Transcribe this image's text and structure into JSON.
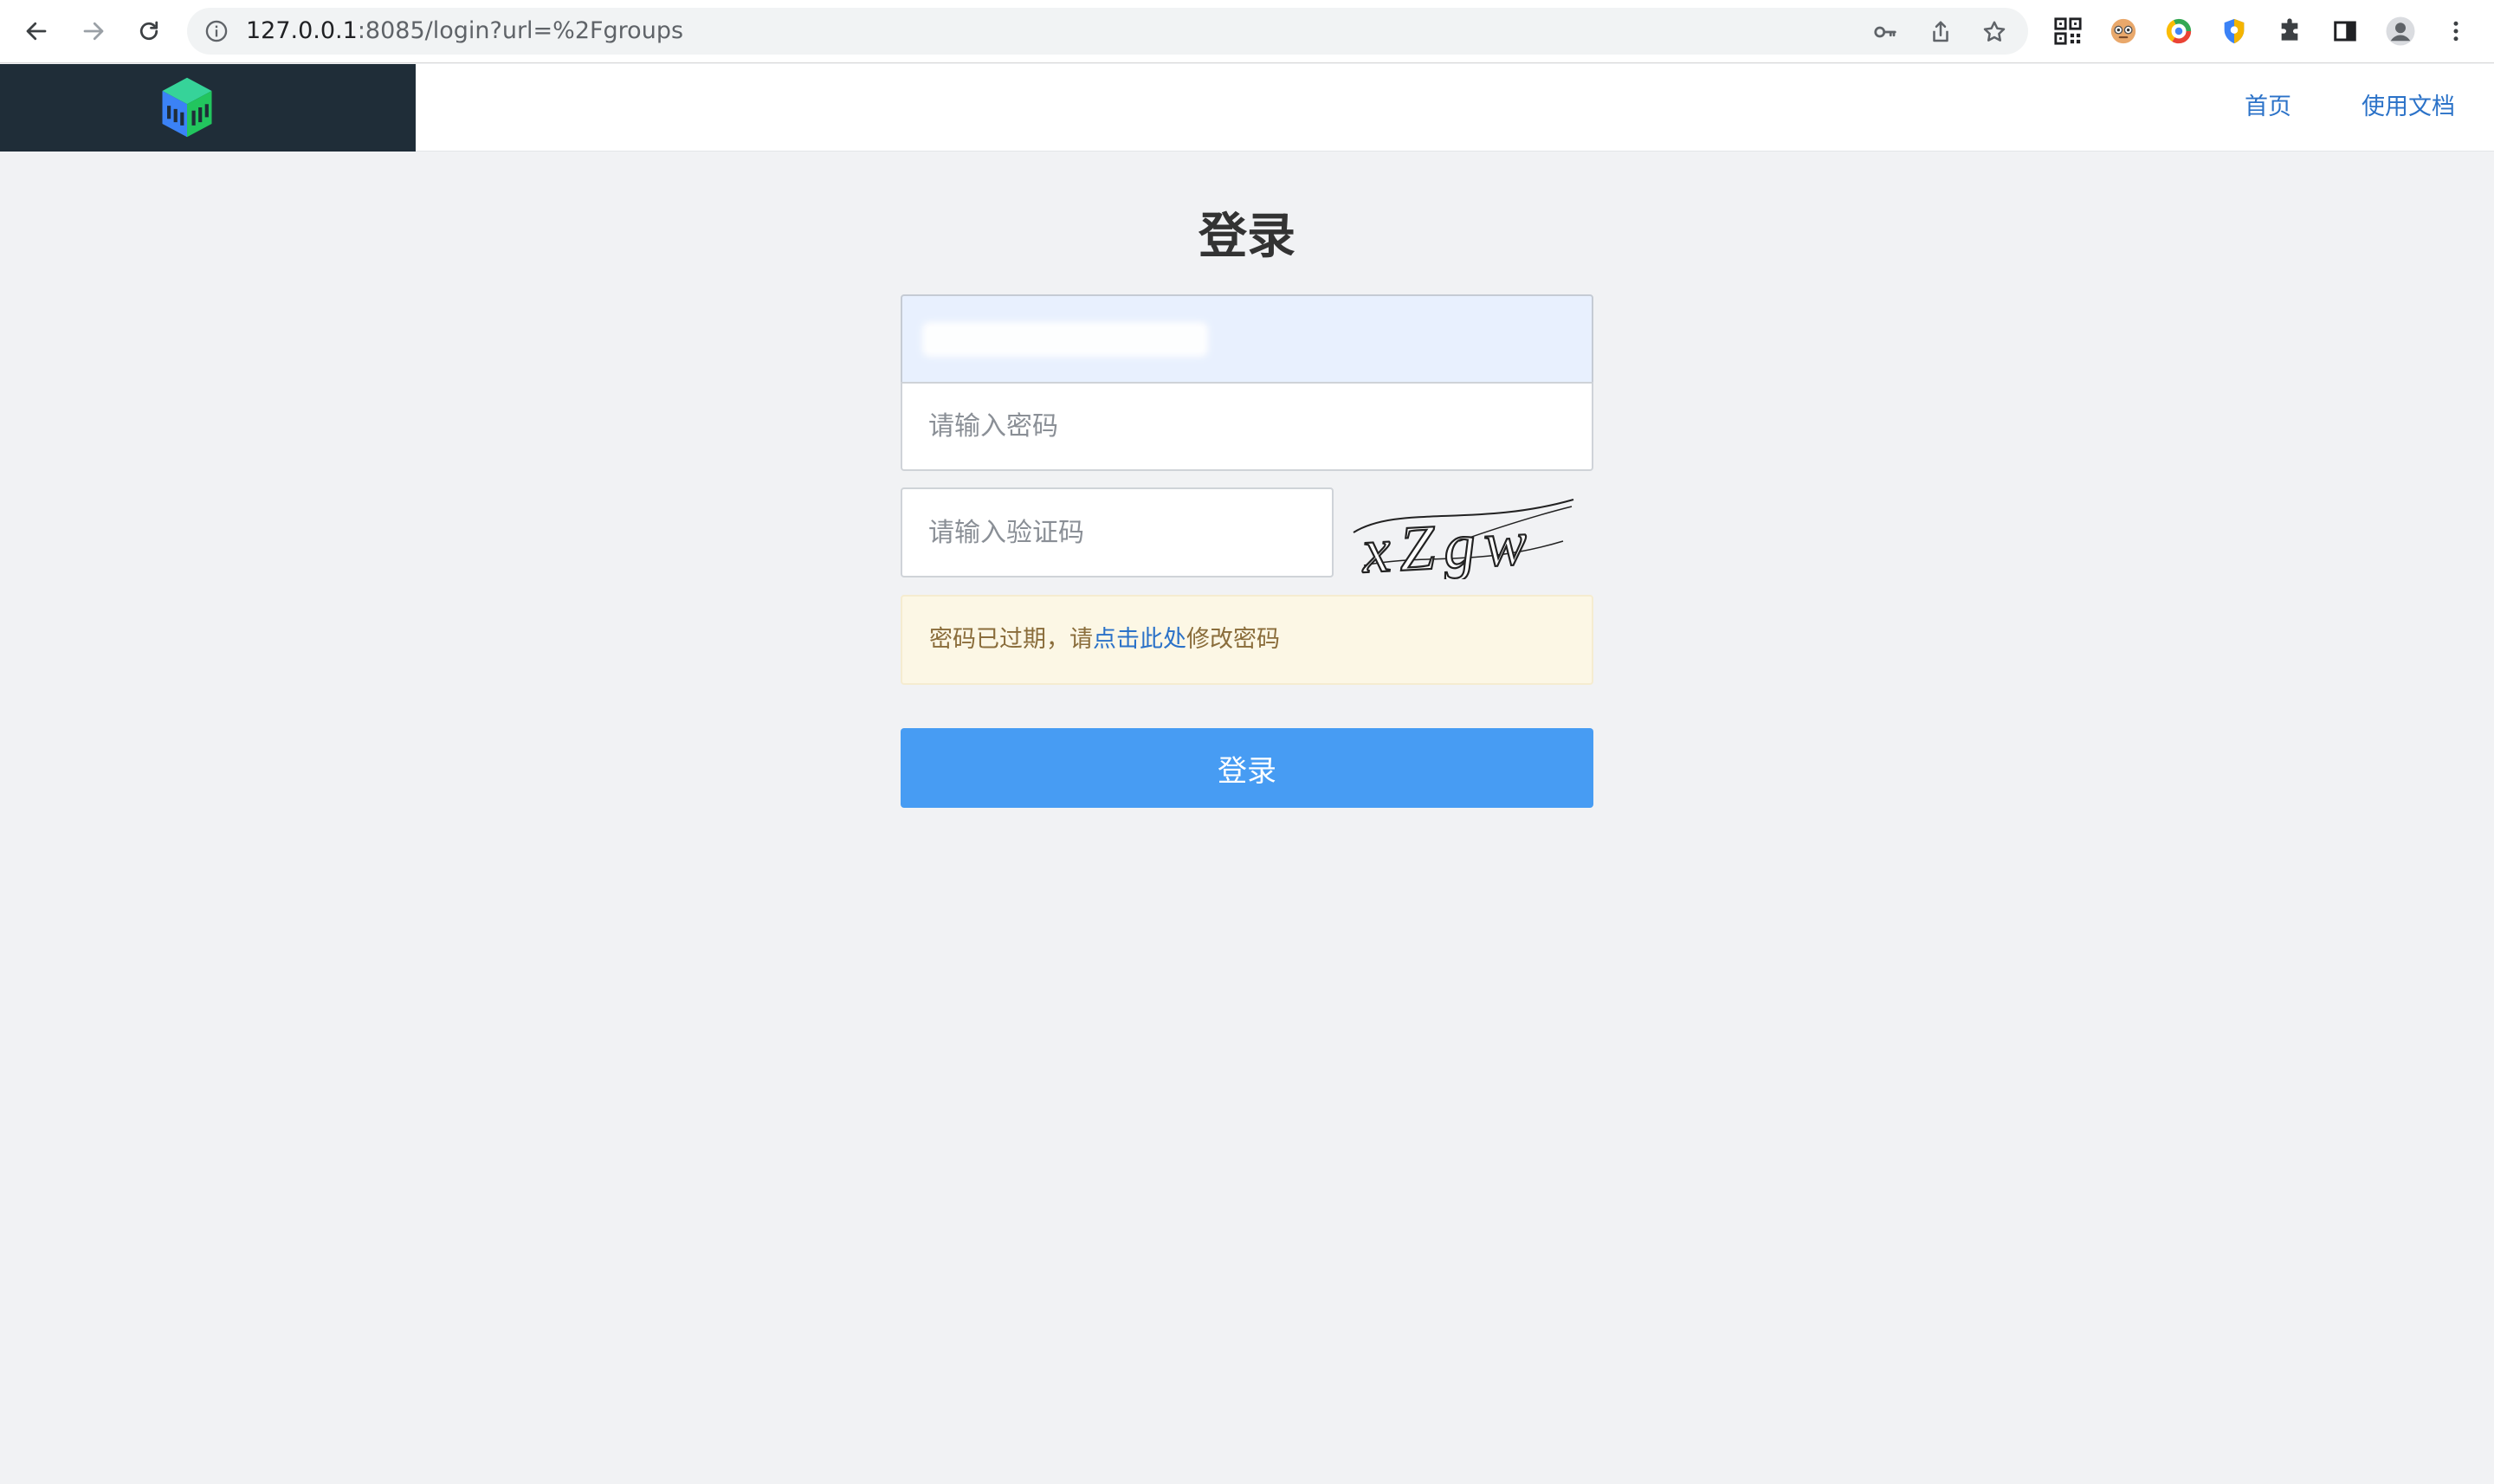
{
  "browser": {
    "url_host": "127.0.0.1",
    "url_rest": ":8085/login?url=%2Fgroups",
    "icons": [
      "back-icon",
      "forward-icon",
      "reload-icon",
      "info-icon",
      "key-icon",
      "share-icon",
      "star-icon",
      "qr-code-icon",
      "extension-face-icon",
      "extension-ring-icon",
      "extension-shield-icon",
      "puzzle-icon",
      "side-panel-icon",
      "profile-icon",
      "more-menu-icon"
    ]
  },
  "header": {
    "nav_home": "首页",
    "nav_docs": "使用文档"
  },
  "login": {
    "title": "登录",
    "password_placeholder": "请输入密码",
    "captcha_placeholder": "请输入验证码",
    "captcha_text": "xZgw",
    "alert_prefix": "密码已过期，请",
    "alert_link": "点击此处",
    "alert_suffix": "修改密码",
    "submit_label": "登录"
  },
  "colors": {
    "brand_dark": "#1f2d38",
    "link": "#2b72c8",
    "primary_button": "#479cf3",
    "alert_background": "#fcf7e5",
    "autofill_background": "#e8f0fe"
  }
}
